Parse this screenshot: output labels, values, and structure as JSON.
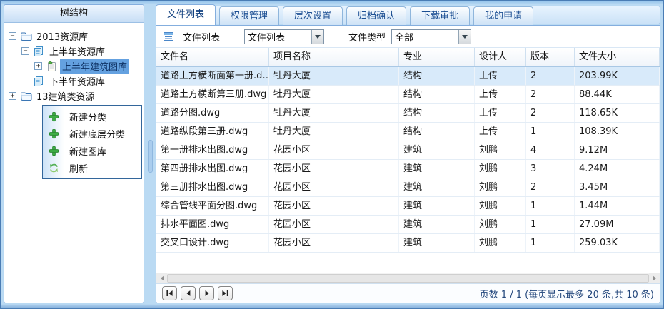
{
  "colors": {
    "frame": "#badaf3",
    "panel_border": "#84aede",
    "selection": "#64a1e0",
    "selected_row": "#d8eafa",
    "tab_text": "#1c4f93",
    "plus_green": "#3fae46"
  },
  "tree": {
    "header": "树结构",
    "nodes": [
      {
        "label": "2013资源库",
        "icon": "folder-icon",
        "expander": "minus",
        "indent": 0,
        "selected": false
      },
      {
        "label": "上半年资源库",
        "icon": "documents-icon",
        "expander": "minus",
        "indent": 1,
        "selected": false
      },
      {
        "label": "上半年建筑图库",
        "icon": "library-icon",
        "expander": "plus",
        "indent": 2,
        "selected": true
      },
      {
        "label": "下半年资源库",
        "icon": "documents-icon",
        "expander": "none",
        "indent": 1,
        "selected": false
      },
      {
        "label": "13建筑类资源",
        "icon": "folder-icon",
        "expander": "plus",
        "indent": 0,
        "selected": false
      }
    ]
  },
  "context_menu": {
    "items": [
      {
        "id": "new-category",
        "label": "新建分类",
        "icon": "plus-icon"
      },
      {
        "id": "new-bottom-category",
        "label": "新建底层分类",
        "icon": "plus-icon"
      },
      {
        "id": "new-library",
        "label": "新建图库",
        "icon": "plus-icon"
      },
      {
        "id": "refresh",
        "label": "刷新",
        "icon": "refresh-icon"
      }
    ]
  },
  "tabs": [
    {
      "id": "file-list",
      "label": "文件列表",
      "active": true
    },
    {
      "id": "permission-management",
      "label": "权限管理",
      "active": false
    },
    {
      "id": "level-settings",
      "label": "层次设置",
      "active": false
    },
    {
      "id": "archive-confirm",
      "label": "归档确认",
      "active": false
    },
    {
      "id": "download-approval",
      "label": "下载审批",
      "active": false
    },
    {
      "id": "my-applications",
      "label": "我的申请",
      "active": false
    }
  ],
  "toolbar": {
    "icon": "list-icon",
    "label": "文件列表",
    "view_select": {
      "value": "文件列表"
    },
    "type_label": "文件类型",
    "type_select": {
      "value": "全部"
    }
  },
  "table": {
    "columns": [
      "文件名",
      "项目名称",
      "专业",
      "设计人",
      "版本",
      "文件大小"
    ],
    "selected_row_index": 0,
    "rows": [
      [
        "道路土方横断面第一册.d…",
        "牡丹大厦",
        "结构",
        "上传",
        "2",
        "203.99K"
      ],
      [
        "道路土方横断第三册.dwg",
        "牡丹大厦",
        "结构",
        "上传",
        "2",
        "88.44K"
      ],
      [
        "道路分图.dwg",
        "牡丹大厦",
        "结构",
        "上传",
        "2",
        "118.65K"
      ],
      [
        "道路纵段第三册.dwg",
        "牡丹大厦",
        "结构",
        "上传",
        "1",
        "108.39K"
      ],
      [
        "第一册排水出图.dwg",
        "花园小区",
        "建筑",
        "刘鹏",
        "4",
        "9.12M"
      ],
      [
        "第四册排水出图.dwg",
        "花园小区",
        "建筑",
        "刘鹏",
        "3",
        "4.24M"
      ],
      [
        "第三册排水出图.dwg",
        "花园小区",
        "建筑",
        "刘鹏",
        "2",
        "3.45M"
      ],
      [
        "综合管线平面分图.dwg",
        "花园小区",
        "建筑",
        "刘鹏",
        "1",
        "1.44M"
      ],
      [
        "排水平面图.dwg",
        "花园小区",
        "建筑",
        "刘鹏",
        "1",
        "27.09M"
      ],
      [
        "交叉口设计.dwg",
        "花园小区",
        "建筑",
        "刘鹏",
        "1",
        "259.03K"
      ]
    ]
  },
  "pagination": {
    "text": "页数  1 / 1  (每页显示最多 20 条,共 10 条)"
  }
}
